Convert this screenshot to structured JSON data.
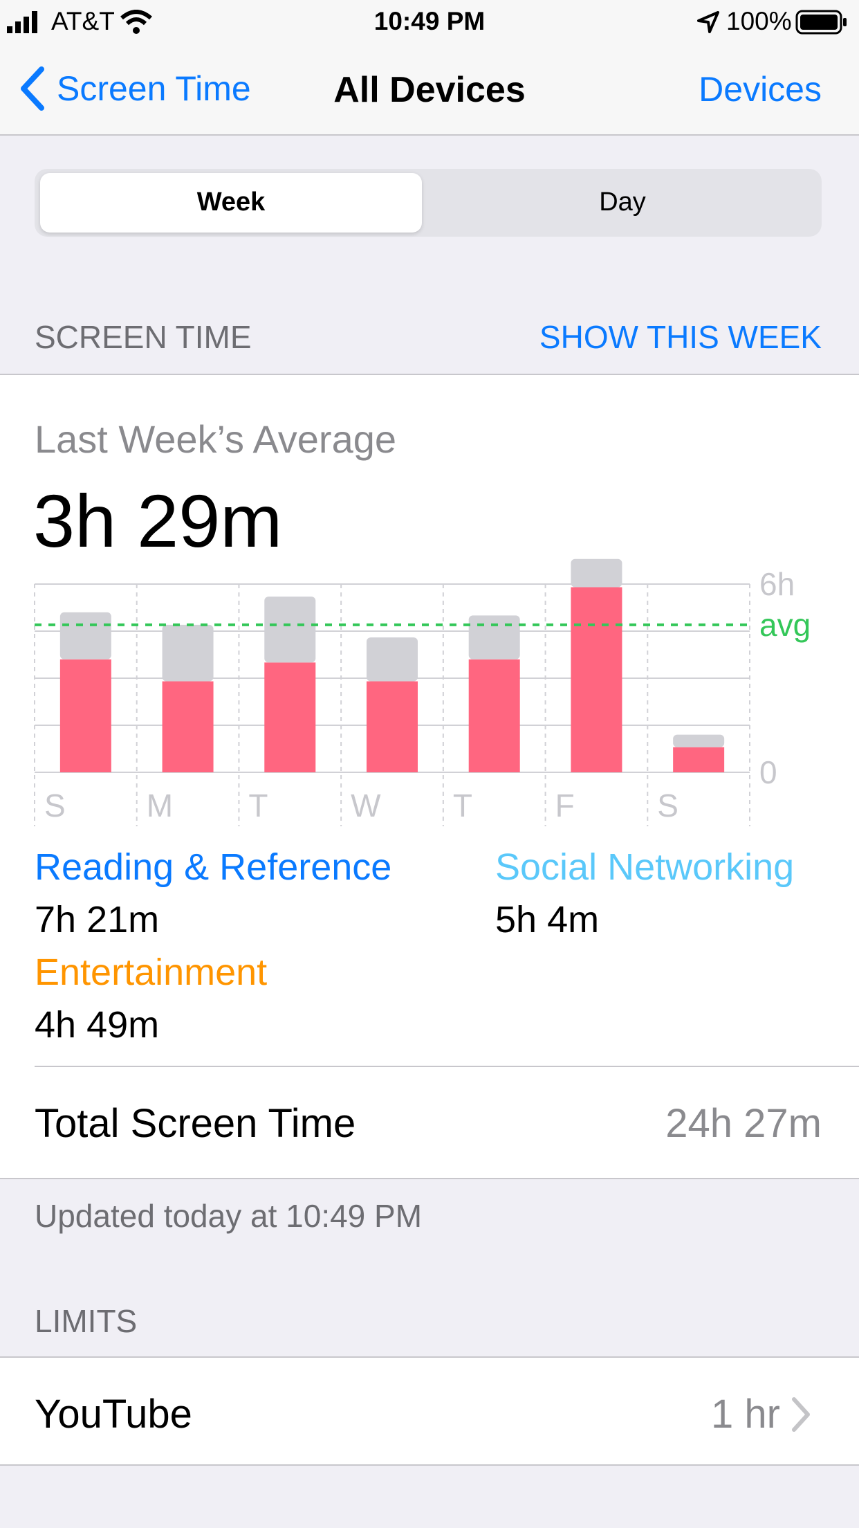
{
  "status_bar": {
    "carrier": "AT&T",
    "time": "10:49 PM",
    "battery": "100%"
  },
  "nav": {
    "back_label": "Screen Time",
    "title": "All Devices",
    "right_label": "Devices"
  },
  "segments": {
    "week": "Week",
    "day": "Day",
    "selected": "Week"
  },
  "screen_time_section": {
    "header": "SCREEN TIME",
    "link": "SHOW THIS WEEK"
  },
  "summary": {
    "label": "Last Week’s Average",
    "value": "3h 29m"
  },
  "chart_data": {
    "type": "bar",
    "categories": [
      "S",
      "M",
      "T",
      "W",
      "T",
      "F",
      "S"
    ],
    "series": [
      {
        "name": "Category usage (pink)",
        "color": "#ff6680",
        "values": [
          3.6,
          2.9,
          3.5,
          2.9,
          3.6,
          5.9,
          0.8
        ]
      },
      {
        "name": "Other (gray)",
        "color": "#d1d1d6",
        "values": [
          1.5,
          1.8,
          2.1,
          1.4,
          1.4,
          0.9,
          0.4
        ]
      }
    ],
    "stacked": true,
    "ylim": [
      0,
      8
    ],
    "y_tick_labels": {
      "top": "6h",
      "bottom": "0"
    },
    "average_label": "avg",
    "average_value": 4.7,
    "average_color": "#34c759",
    "grid": true
  },
  "categories": [
    {
      "name": "Reading & Reference",
      "value": "7h 21m",
      "color": "#0a7aff"
    },
    {
      "name": "Social Networking",
      "value": "5h 4m",
      "color": "#5ac8fa"
    },
    {
      "name": "Entertainment",
      "value": "4h 49m",
      "color": "#ff9500"
    }
  ],
  "total": {
    "label": "Total Screen Time",
    "value": "24h 27m"
  },
  "updated": "Updated today at 10:49 PM",
  "limits_section": {
    "header": "LIMITS"
  },
  "limits": [
    {
      "app": "YouTube",
      "value": "1 hr"
    }
  ]
}
